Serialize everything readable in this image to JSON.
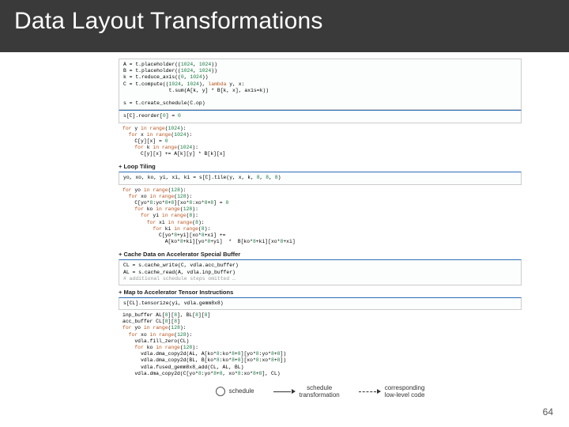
{
  "header": {
    "title": "Data Layout Transformations"
  },
  "blocks": {
    "prelude": "A = t.placeholder((1024, 1024))\nB = t.placeholder((1024, 1024))\nk = t.reduce_axis((0, 1024))\nC = t.compute((1024, 1024), lambda y, x:\n               t.sum(A[k, y] * B[k, x], axis=k))\n\ns = t.create_schedule(C.op)",
    "initial_sched": "s[C].reorder[0] = 0",
    "initial_expl": "for y in range(1024):\n  for x in range(1024):\n    C[y][x] = 0\n    for k in range(1024):\n      C[y][x] += A[k][y] * B[k][x]",
    "tiling_label": "+ Loop Tiling",
    "tiling_sched": "yo, xo, ko, yi, xi, ki = s[C].tile(y, x, k, 8, 8, 8)",
    "tiling_expl": "for yo in range(128):\n  for xo in range(128):\n    C[yo*8:yo*8+8][xo*8:xo*8+8] = 0\n    for ko in range(128):\n      for yi in range(8):\n        for xi in range(8):\n          for ki in range(8):\n            C[yo*8+yi][xo*8+xi] +=\n              A[ko*8+ki][yo*8+yi]  *  B[ko*8+ki][xo*8+xi]",
    "cache_label": "+ Cache Data on Accelerator Special Buffer",
    "cache_sched": "CL = s.cache_write(C, vdla.acc_buffer)\nAL = s.cache_read(A, vdla.inp_buffer)\n# additional schedule steps omitted …",
    "map_label": "+ Map to Accelerator Tensor Instructions",
    "map_sched": "s[CL].tensorize(yi, vdla.gemm8x8)",
    "map_expl": "inp_buffer AL[8][8], BL[8][8]\nacc_buffer CL[8][8]\nfor yo in range(128):\n  for xo in range(128):\n    vdla.fill_zero(CL)\n    for ko in range(128):\n      vdla.dma_copy2d(AL, A[ko*8:ko*8+8][yo*8:yo*8+8])\n      vdla.dma_copy2d(BL, B[ko*8:ko*8+8][xo*8:xo*8+8])\n      vdla.fused_gemm8x8_add(CL, AL, BL)\n    vdla.dma_copy2d(C[yo*8:yo*8+8, xo*8:xo*8+8], CL)"
  },
  "legend": {
    "sched": "schedule",
    "trans": "schedule\ntransformation",
    "corr": "corresponding\nlow-level code"
  },
  "page": "64"
}
